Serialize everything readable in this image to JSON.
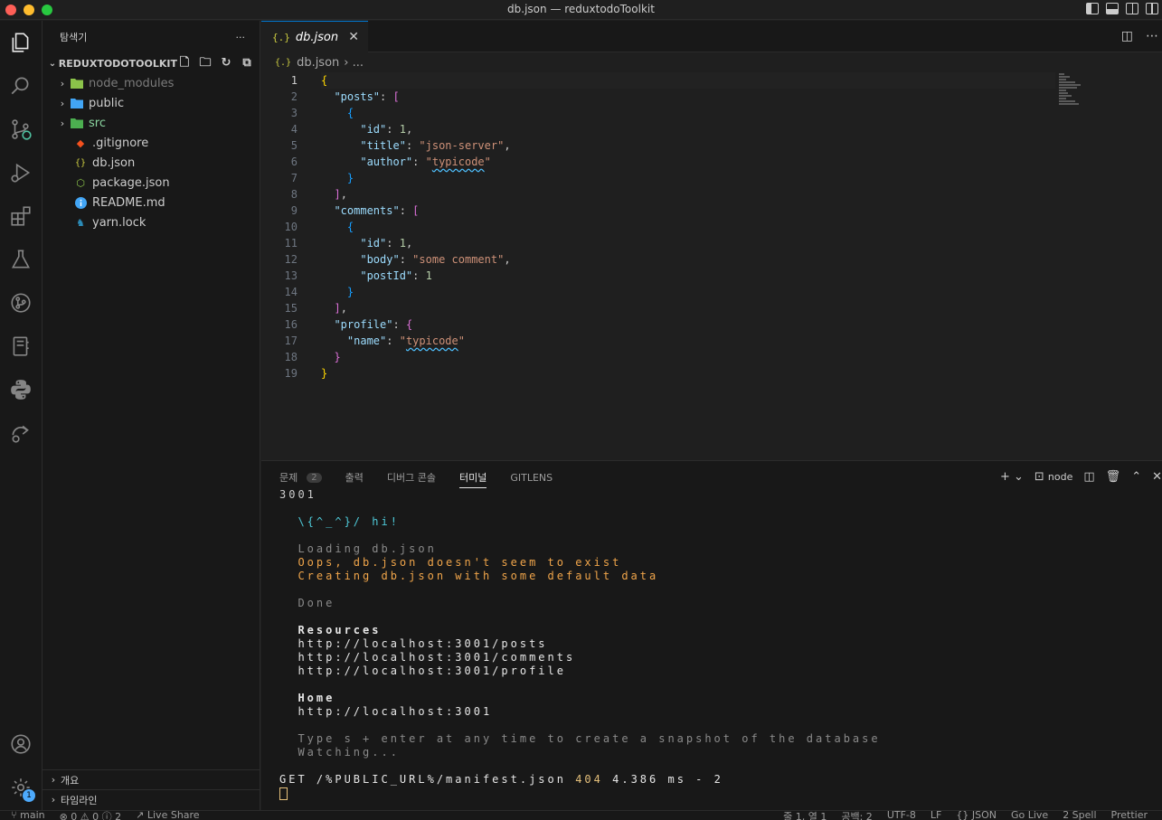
{
  "window": {
    "title": "db.json — reduxtodoToolkit"
  },
  "sidebar": {
    "header": "탐색기",
    "more": "···",
    "project": "REDUXTODOTOOLKIT",
    "items": [
      {
        "label": "node_modules",
        "type": "folder"
      },
      {
        "label": "public",
        "type": "folder"
      },
      {
        "label": "src",
        "type": "folder"
      },
      {
        "label": ".gitignore",
        "type": "file"
      },
      {
        "label": "db.json",
        "type": "file"
      },
      {
        "label": "package.json",
        "type": "file"
      },
      {
        "label": "README.md",
        "type": "file"
      },
      {
        "label": "yarn.lock",
        "type": "file"
      }
    ],
    "outline": "개요",
    "timeline": "타임라인"
  },
  "editor": {
    "tab_label": "db.json",
    "tab_icon": "{.}",
    "breadcrumb_file": "db.json",
    "breadcrumb_rest": "› ...",
    "line_numbers": [
      "1",
      "2",
      "3",
      "4",
      "5",
      "6",
      "7",
      "8",
      "9",
      "10",
      "11",
      "12",
      "13",
      "14",
      "15",
      "16",
      "17",
      "18",
      "19"
    ]
  },
  "panel": {
    "tabs": [
      "문제",
      "출력",
      "디버그 콘솔",
      "터미널",
      "GITLENS"
    ],
    "problems_count": "2",
    "shell": "node",
    "terminal": {
      "port_line": "3001",
      "hi": "\\{^_^}/ hi!",
      "loading": "Loading db.json",
      "oops": "Oops, db.json doesn't seem to exist",
      "creating": "Creating db.json with some default data",
      "done": "Done",
      "resources": "Resources",
      "res1": "http://localhost:3001/posts",
      "res2": "http://localhost:3001/comments",
      "res3": "http://localhost:3001/profile",
      "home": "Home",
      "home_url": "http://localhost:3001",
      "hint": "Type s + enter at any time to create a snapshot of the database",
      "watching": "Watching...",
      "get_prefix": "GET /%PUBLIC_URL%/manifest.json",
      "get_status": "404",
      "get_suffix": "4.386 ms - 2"
    }
  },
  "activity": {
    "settings_badge": "1"
  },
  "status": {
    "branch": "main",
    "problems": "⊗ 0 ⚠ 0 ⓘ 2",
    "liveshare": "Live Share",
    "position": "줄 1, 열 1",
    "spaces": "공백: 2",
    "encoding": "UTF-8",
    "eol": "LF",
    "language": "{} JSON",
    "golive": "Go Live",
    "spell": "2 Spell",
    "prettier": "Prettier"
  }
}
